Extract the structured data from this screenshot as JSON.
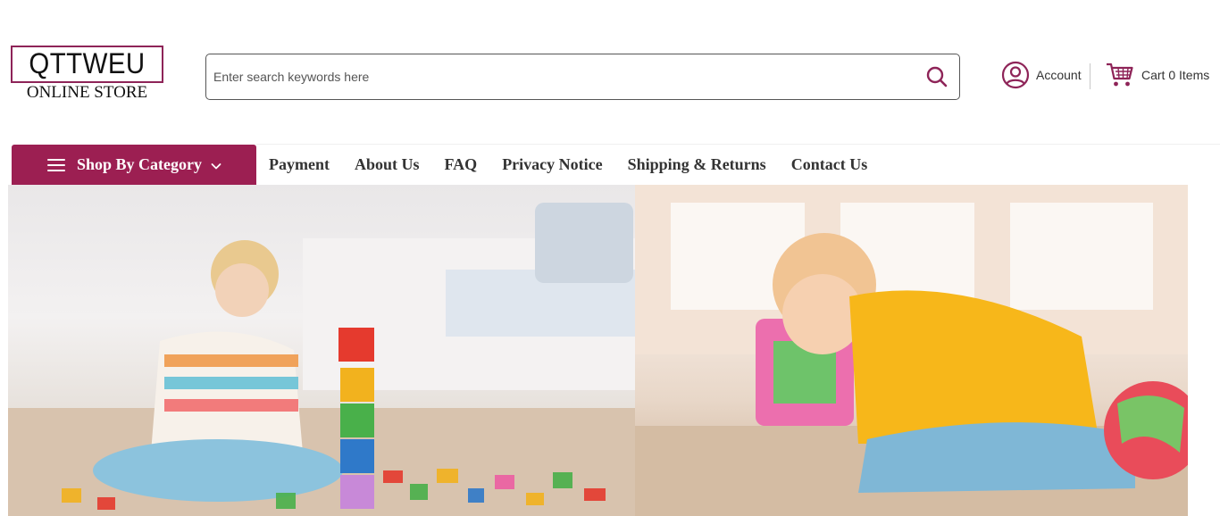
{
  "header": {
    "logo": {
      "title": "QTTWEU",
      "subtitle": "ONLINE STORE"
    },
    "search": {
      "placeholder": "Enter search keywords here",
      "value": ""
    },
    "account": {
      "label": "Account"
    },
    "cart": {
      "label": "Cart 0 Items"
    }
  },
  "nav": {
    "category_button": "Shop By Category",
    "links": [
      "Payment",
      "About Us",
      "FAQ",
      "Privacy Notice",
      "Shipping & Returns",
      "Contact Us"
    ]
  },
  "colors": {
    "brand": "#9c1f52",
    "icon": "#8e2458"
  },
  "icons": [
    "search-icon",
    "user-circle-icon",
    "cart-icon",
    "hamburger-icon",
    "chevron-down-icon"
  ]
}
